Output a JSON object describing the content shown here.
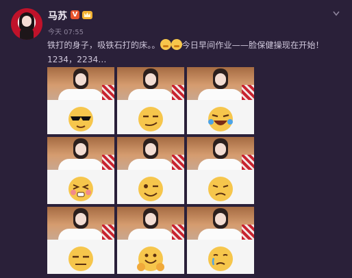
{
  "post": {
    "username": "马苏",
    "verified_label": "V",
    "timestamp": "今天 07:55",
    "text_part1": "铁打的身子，吸铁石打的床。。",
    "text_part2": "今日早间作业——脸保健操现在开始！1234，2234…"
  },
  "icons": {
    "verified": "verified-badge-icon",
    "member": "member-crown-icon",
    "menu": "chevron-down-icon",
    "inline_emoji": "sleepy-face-icon"
  },
  "colors": {
    "background": "#2a2039",
    "accent": "#e8542c",
    "emoji": "#f6c64c"
  },
  "photos": [
    {
      "emoji": "sunglasses-face"
    },
    {
      "emoji": "smirk-face"
    },
    {
      "emoji": "laughing-tears-face"
    },
    {
      "emoji": "blushing-face"
    },
    {
      "emoji": "winking-face"
    },
    {
      "emoji": "sad-face"
    },
    {
      "emoji": "skeptical-face"
    },
    {
      "emoji": "grinning-hands-face"
    },
    {
      "emoji": "crying-face"
    }
  ]
}
